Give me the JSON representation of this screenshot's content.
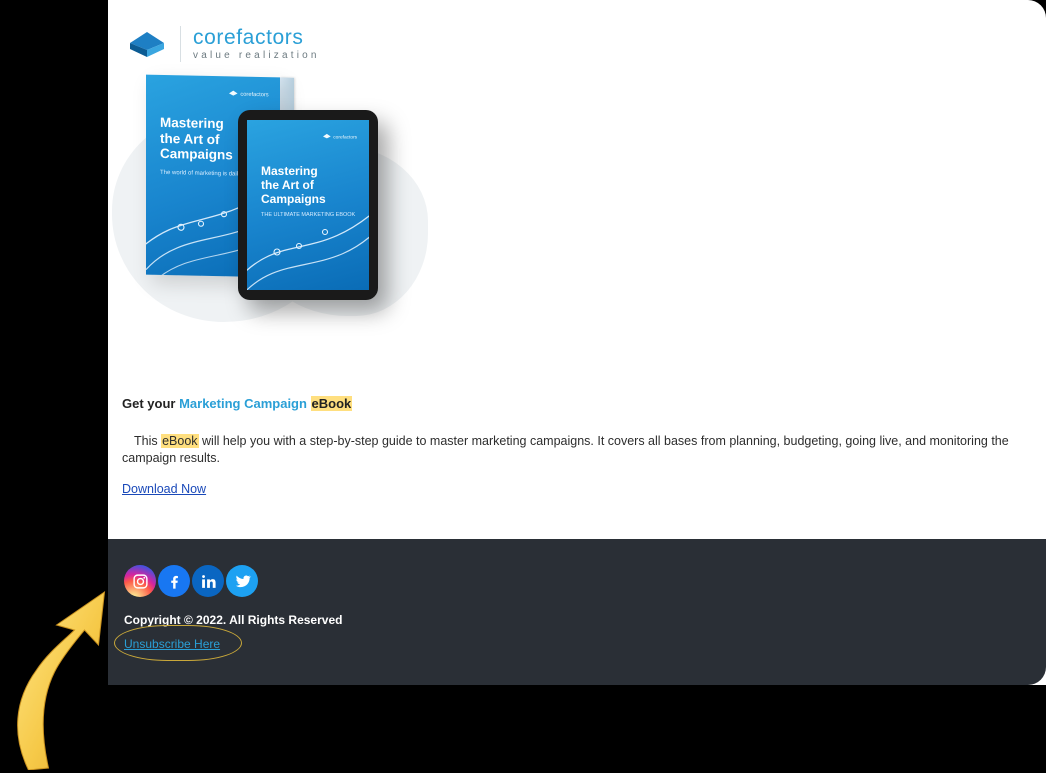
{
  "brand": {
    "name": "corefactors",
    "tagline": "value realization"
  },
  "hero": {
    "book_title": "Mastering\nthe Art of\nCampaigns",
    "book_subtitle": "The world of marketing is daily",
    "tablet_title": "Mastering\nthe Art of\nCampaigns",
    "tablet_subtitle": "THE ULTIMATE MARKETING EBOOK"
  },
  "cta": {
    "headline_pre": "Get your ",
    "headline_mc": "Marketing Campaign ",
    "headline_hl": "eBook",
    "body_pre": "This ",
    "body_hl": "eBook",
    "body_post": " will help you with a step-by-step guide to master marketing campaigns. It covers all bases from planning, budgeting, going live, and monitoring the campaign results.",
    "download_label": "Download Now"
  },
  "footer": {
    "socials": [
      "instagram",
      "facebook",
      "linkedin",
      "twitter"
    ],
    "copyright": "Copyright © 2022. All Rights Reserved",
    "unsubscribe_label": "Unsubscribe Here"
  }
}
